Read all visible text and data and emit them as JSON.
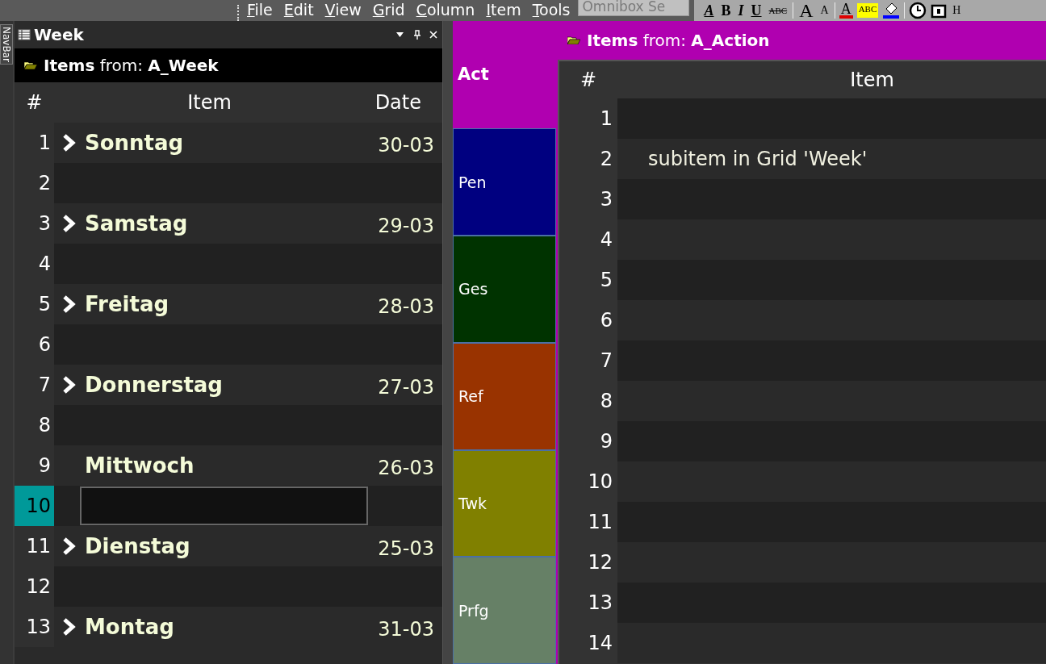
{
  "menu": [
    "File",
    "Edit",
    "View",
    "Grid",
    "Column",
    "Item",
    "Tools"
  ],
  "omnibox": {
    "placeholder": "Omnibox Se"
  },
  "toolbar": [
    {
      "kind": "highlight",
      "label": "A"
    },
    {
      "kind": "bold",
      "label": "B"
    },
    {
      "kind": "italic",
      "label": "I"
    },
    {
      "kind": "underline",
      "label": "U"
    },
    {
      "kind": "strike",
      "label": "ABC"
    },
    {
      "kind": "sep"
    },
    {
      "kind": "big",
      "label": "A"
    },
    {
      "kind": "small",
      "label": "A"
    },
    {
      "kind": "sep"
    },
    {
      "kind": "fontcolor",
      "label": "A"
    },
    {
      "kind": "backcolor",
      "label": "ABC"
    },
    {
      "kind": "fill"
    },
    {
      "kind": "sep"
    },
    {
      "kind": "clock"
    },
    {
      "kind": "lock"
    },
    {
      "kind": "small",
      "label": "H"
    }
  ],
  "navbar": {
    "label": "NavBar"
  },
  "left_pane": {
    "title": "Week",
    "source_prefix": "Items",
    "source_mid": "from:",
    "source_name": "A_Week",
    "columns": [
      "#",
      "Item",
      "Date"
    ],
    "rows": [
      {
        "num": "1",
        "item": "Sonntag",
        "date": "30-03",
        "expandable": true,
        "selected": false
      },
      {
        "num": "2",
        "selected": false
      },
      {
        "num": "3",
        "item": "Samstag",
        "date": "29-03",
        "expandable": true,
        "selected": false
      },
      {
        "num": "4",
        "selected": false
      },
      {
        "num": "5",
        "item": "Freitag",
        "date": "28-03",
        "expandable": true,
        "selected": false
      },
      {
        "num": "6",
        "selected": false
      },
      {
        "num": "7",
        "item": "Donnerstag",
        "date": "27-03",
        "expandable": true,
        "selected": false
      },
      {
        "num": "8",
        "selected": false
      },
      {
        "num": "9",
        "item": "Mittwoch",
        "date": "26-03",
        "expandable": false,
        "selected": false
      },
      {
        "num": "10",
        "selected": true,
        "editing": true
      },
      {
        "num": "11",
        "item": "Dienstag",
        "date": "25-03",
        "expandable": true,
        "selected": false
      },
      {
        "num": "12",
        "selected": false
      },
      {
        "num": "13",
        "item": "Montag",
        "date": "31-03",
        "expandable": true,
        "selected": false
      }
    ]
  },
  "categories": [
    {
      "label": "Act",
      "color": "#b000b0"
    },
    {
      "label": "Pen",
      "color": "#000080"
    },
    {
      "label": "Ges",
      "color": "#003300"
    },
    {
      "label": "Ref",
      "color": "#993300"
    },
    {
      "label": "Twk",
      "color": "#808000"
    },
    {
      "label": "Prfg",
      "color": "#668066"
    }
  ],
  "right_pane": {
    "source_prefix": "Items",
    "source_mid": "from:",
    "source_name": "A_Action",
    "columns": [
      "#",
      "Item"
    ],
    "rows": [
      {
        "num": "1"
      },
      {
        "num": "2",
        "item": "subitem in Grid 'Week'"
      },
      {
        "num": "3"
      },
      {
        "num": "4"
      },
      {
        "num": "5"
      },
      {
        "num": "6"
      },
      {
        "num": "7"
      },
      {
        "num": "8"
      },
      {
        "num": "9"
      },
      {
        "num": "10"
      },
      {
        "num": "11"
      },
      {
        "num": "12"
      },
      {
        "num": "13"
      },
      {
        "num": "14"
      }
    ]
  }
}
